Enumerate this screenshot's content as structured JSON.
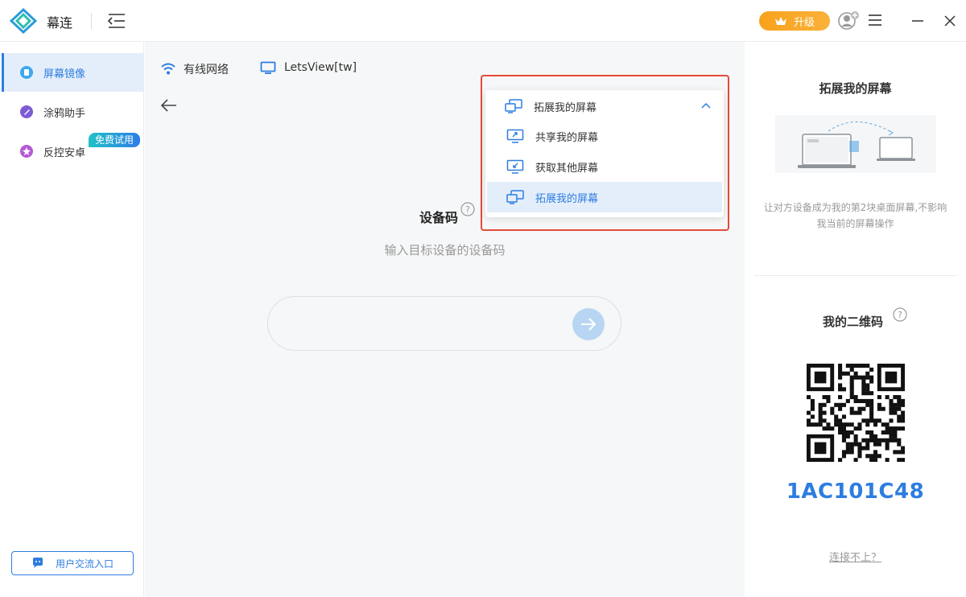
{
  "titlebar": {
    "app_name": "幕连",
    "upgrade_label": "升级",
    "icons": [
      "logo-icon",
      "collapse-sidebar-icon",
      "crown-icon",
      "avatar-icon",
      "menu-icon",
      "minimize-icon",
      "close-icon"
    ]
  },
  "sidebar": {
    "items": [
      {
        "label": "屏幕镜像",
        "icon": "screen-mirror-icon",
        "active": true
      },
      {
        "label": "涂鸦助手",
        "icon": "doodle-icon",
        "active": false
      },
      {
        "label": "反控安卓",
        "icon": "android-control-icon",
        "active": false
      }
    ],
    "trial_badge": "免费试用",
    "community_label": "用户交流入口"
  },
  "main": {
    "network_label": "有线网络",
    "device_name": "LetsView[tw]",
    "code_title": "设备码",
    "code_subtitle": "输入目标设备的设备码",
    "code_value": ""
  },
  "dropdown": {
    "current": "拓展我的屏幕",
    "options": [
      "共享我的屏幕",
      "获取其他屏幕",
      "拓展我的屏幕"
    ],
    "selected_index": 2
  },
  "right_panel": {
    "title": "拓展我的屏幕",
    "description": "让对方设备成为我的第2块桌面屏幕,不影响我当前的屏幕操作",
    "qr_title": "我的二维码",
    "device_id": "1AC101C48",
    "help_link": "连接不上？"
  },
  "colors": {
    "accent": "#2d7de0",
    "upgrade": "#f7a21b",
    "highlight_frame": "#e34a3a",
    "selected_bg": "#e4eefb"
  }
}
